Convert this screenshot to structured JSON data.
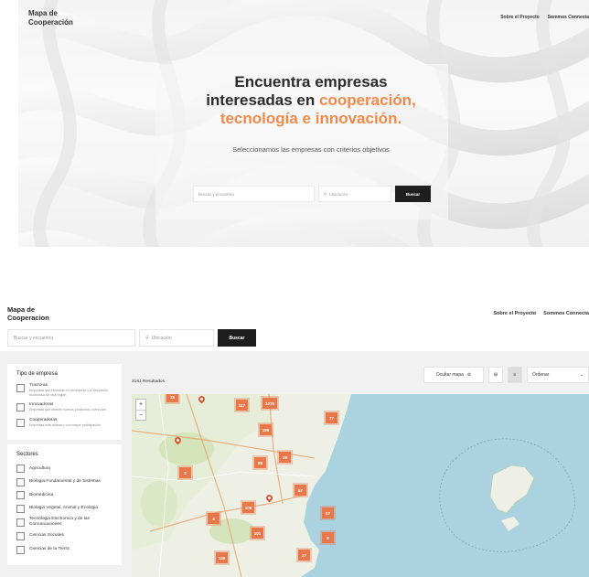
{
  "hero": {
    "logo": "Mapa de Cooperación",
    "nav": [
      "Sobre el Proyecto",
      "Sommos Connecta"
    ],
    "title_line1": "Encuentra empresas",
    "title_line2_prefix": "interesadas en ",
    "title_line2_accent": "cooperación,",
    "title_line3_accent": "tecnología e innovación.",
    "subtitle": "Seleccionamos las empresas con criterios objetivos",
    "search_placeholder": "Buscar y encuentra",
    "location_placeholder": "Ubicación",
    "search_button": "Buscar",
    "accent_color": "#f08a4b"
  },
  "app": {
    "logo": "Mapa de Cooperacion",
    "nav": [
      "Sobre el Proyecto",
      "Sommos Connecta"
    ],
    "search_placeholder": "Buscar y encuentra",
    "location_placeholder": "Ubicación",
    "search_button": "Buscar",
    "filters": {
      "company_type_title": "Tipo de empresa",
      "company_types": [
        {
          "label": "Tractoras",
          "desc": "Empresas que fomentan el crecimiento y el desarrollo económico de una región"
        },
        {
          "label": "Innovadoras",
          "desc": "Empresas que ofrecen nuevos productos o servicios"
        },
        {
          "label": "Cooperadoras",
          "desc": "Empresas más activas y con mayor participación"
        }
      ],
      "sectors_title": "Sectores",
      "sectors": [
        "Agricultura",
        "Biologia Fundamental y de Sistemas",
        "Biomedicina",
        "Biologia Vegetal, Animal y Ecologia",
        "Tecnologia Electronica y de las Comunicaciones",
        "Ciencias Sociales",
        "Ciencias de la Tierra"
      ]
    },
    "results": "3181 Resultados",
    "toolbar": {
      "hide_map": "Ocultar mapa",
      "order": "Ordenar"
    },
    "map": {
      "clusters": [
        "15",
        "117",
        "1076",
        "77",
        "199",
        "88",
        "19",
        "2",
        "67",
        "109",
        "4",
        "97",
        "101",
        "8",
        "149",
        "27"
      ]
    }
  }
}
